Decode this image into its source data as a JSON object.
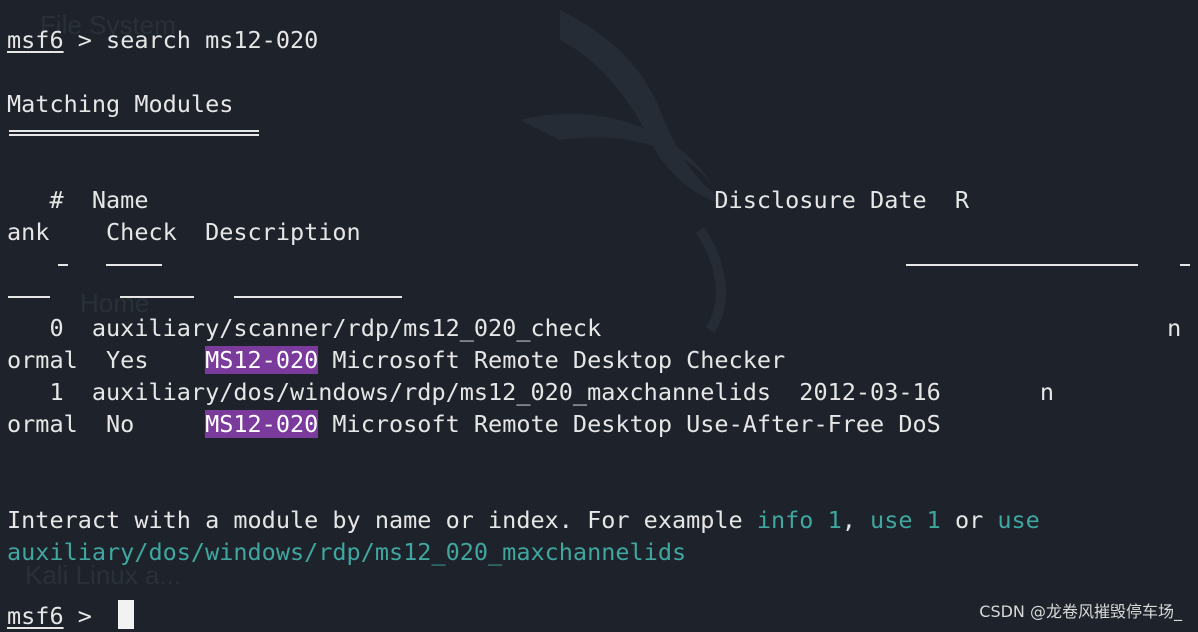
{
  "terminal": {
    "prompt": "msf6",
    "prompt_sep": " > ",
    "command": "search ms12-020",
    "heading": "Matching Modules",
    "table": {
      "header_line1": "   #  Name                                        Disclosure Date  R",
      "header_line2_a": "ank    Check  Description",
      "dash_line1": "   -  ____                                        _______________  -",
      "dash_line2": "___    _____  ___________",
      "rows": [
        {
          "line1": "   0  auxiliary/scanner/rdp/ms12_020_check                                        n",
          "line2_prefix": "ormal  Yes    ",
          "match": "MS12-020",
          "line2_suffix": " Microsoft Remote Desktop Checker"
        },
        {
          "line1": "   1  auxiliary/dos/windows/rdp/ms12_020_maxchannelids  2012-03-16       n",
          "line2_prefix": "ormal  No     ",
          "match": "MS12-020",
          "line2_suffix": " Microsoft Remote Desktop Use-After-Free DoS"
        }
      ]
    },
    "hint": {
      "text_a": "Interact with a module by name or index. For example ",
      "info_cmd": "info 1",
      "sep": ", ",
      "use_cmd": "use 1",
      "or_word": " or ",
      "use_word": "use",
      "module_path": "auxiliary/dos/windows/rdp/ms12_020_maxchannelids"
    },
    "final_prompt": "msf6",
    "final_prompt_sep": " > "
  },
  "background": {
    "ghost_labels": [
      "File System",
      "Home",
      "Kali Linux a..."
    ]
  },
  "watermark": "CSDN @龙卷风摧毁停车场_",
  "colors": {
    "background": "#1e232b",
    "text": "#e6e6e6",
    "highlight": "#7a3b9c",
    "cyan": "#3fa6a0"
  }
}
